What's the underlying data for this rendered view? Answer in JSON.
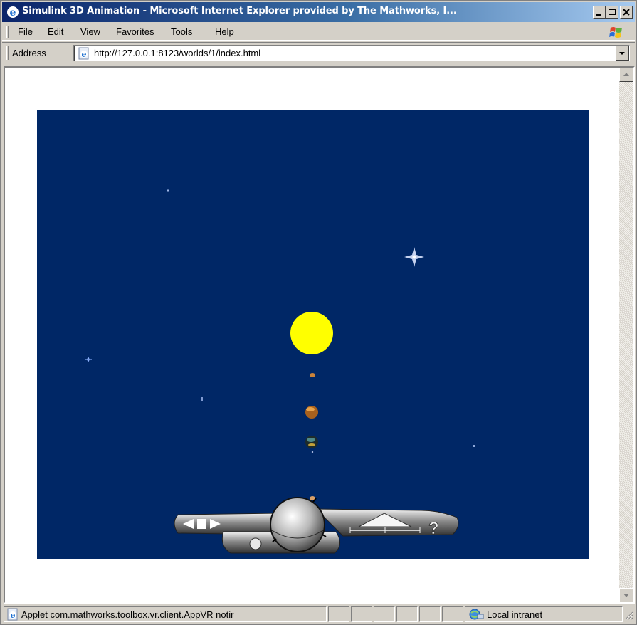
{
  "window": {
    "title": "Simulink 3D Animation - Microsoft Internet Explorer provided by The Mathworks, I...",
    "title_icon": "ie-icon",
    "controls": [
      "minimize-icon",
      "maximize-icon",
      "close-icon"
    ]
  },
  "menu": {
    "items": [
      "File",
      "Edit",
      "View",
      "Favorites",
      "Tools",
      "Help"
    ],
    "logo": "windows-flag-icon"
  },
  "address": {
    "label": "Address",
    "url": "http://127.0.0.1:8123/worlds/1/index.html",
    "page_icon": "ie-page-icon"
  },
  "viewer": {
    "background": "#002766",
    "sun_color": "#ffff00",
    "scene_objects": [
      "sun",
      "planet",
      "planet",
      "planet",
      "planet",
      "stars"
    ],
    "navigation_panel": {
      "icons": [
        "nav-left-icon",
        "nav-stop-icon",
        "nav-right-icon",
        "navigation-sphere",
        "slider-icon",
        "help-icon"
      ],
      "help_label": "?"
    }
  },
  "status": {
    "text": "Applet com.mathworks.toolbox.vr.client.AppVR notir",
    "zone": "Local intranet",
    "zone_icon": "intranet-icon"
  }
}
